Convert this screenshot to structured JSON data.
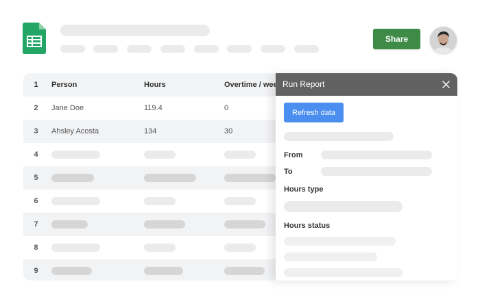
{
  "header": {
    "share_label": "Share"
  },
  "icons": {
    "logo": "google-sheets-icon",
    "avatar": "user-avatar",
    "close": "close-icon"
  },
  "grid": {
    "headers": [
      "Person",
      "Hours",
      "Overtime / week"
    ],
    "row_numbers": [
      "1",
      "2",
      "3",
      "4",
      "5",
      "6",
      "7",
      "8",
      "9"
    ],
    "rows": [
      {
        "person": "Jane Doe",
        "hours": "119.4",
        "overtime": "0"
      },
      {
        "person": "Ahsley Acosta",
        "hours": "134",
        "overtime": "30"
      }
    ]
  },
  "panel": {
    "title": "Run Report",
    "refresh_label": "Refresh data",
    "from_label": "From",
    "to_label": "To",
    "hours_type_label": "Hours type",
    "hours_status_label": "Hours status"
  },
  "colors": {
    "share_green": "#3d8b47",
    "refresh_blue": "#4a8ef0",
    "panel_header": "#616161",
    "sheets_green": "#23a566"
  }
}
